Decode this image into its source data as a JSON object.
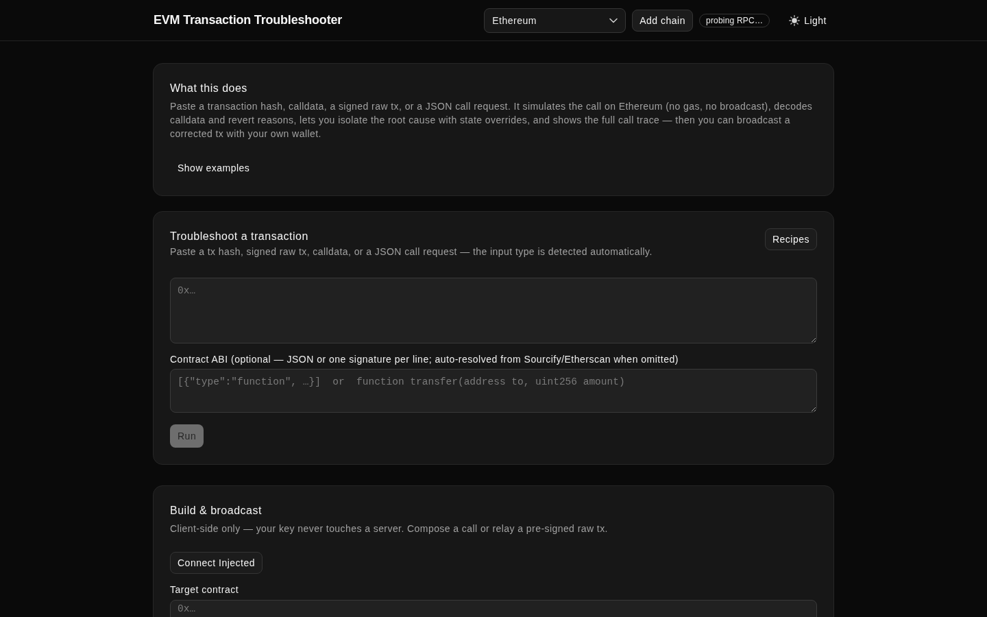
{
  "header": {
    "title": "EVM Transaction Troubleshooter",
    "chain_select": {
      "value": "Ethereum"
    },
    "add_chain_button": "Add chain",
    "status_badge": "probing RPC…",
    "theme_toggle": {
      "label": "Light"
    }
  },
  "about_card": {
    "title": "What this does",
    "description": "Paste a transaction hash, calldata, a signed raw tx, or a JSON call request. It simulates the call on Ethereum (no gas, no broadcast), decodes calldata and revert reasons, lets you isolate the root cause with state overrides, and shows the full call trace — then you can broadcast a corrected tx with your own wallet.",
    "examples_button": "Show examples"
  },
  "troubleshoot_card": {
    "title": "Troubleshoot a transaction",
    "subtitle": "Paste a tx hash, signed raw tx, calldata, or a JSON call request — the input type is detected automatically.",
    "recipes_button": "Recipes",
    "input_field": {
      "placeholder": "0x…"
    },
    "abi_label": "Contract ABI (optional — JSON or one signature per line; auto-resolved from Sourcify/Etherscan when omitted)",
    "abi_field": {
      "placeholder": "[{\"type\":\"function\", …}]  or  function transfer(address to, uint256 amount)"
    },
    "run_button": {
      "label": "Run",
      "disabled": true
    }
  },
  "broadcast_card": {
    "title": "Build & broadcast",
    "subtitle": "Client-side only — your key never touches a server. Compose a call or relay a pre-signed raw tx.",
    "connect_button": "Connect Injected",
    "target_label": "Target contract",
    "target_field": {
      "placeholder": "0x…"
    }
  }
}
